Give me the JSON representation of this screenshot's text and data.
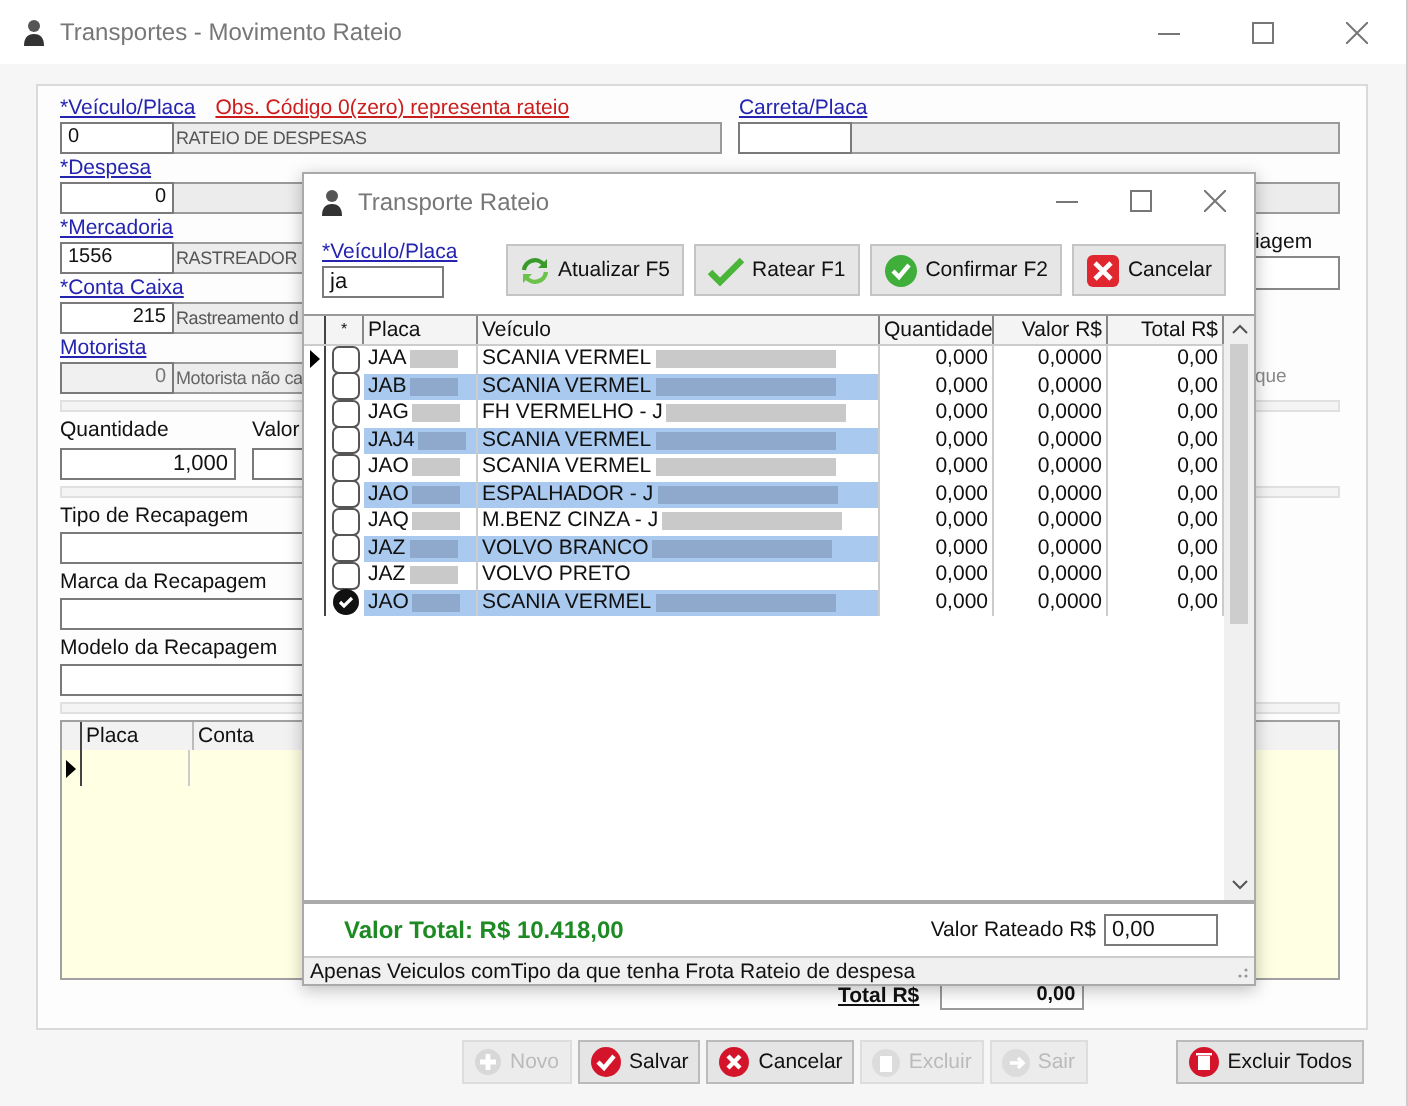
{
  "window": {
    "title": "Transportes - Movimento Rateio"
  },
  "form": {
    "obs": "Obs. Código 0(zero) representa rateio",
    "lookups": [
      {
        "label": "*Veículo/Placa",
        "code": "0",
        "description": "RATEIO DE DESPESAS",
        "kind": "text",
        "disabled": false
      },
      {
        "label": "*Despesa",
        "code": "0",
        "kind": "number",
        "disabled": false
      },
      {
        "label": "*Mercadoria",
        "code": "1556",
        "description": "RASTREADOR",
        "kind": "text",
        "disabled": false
      },
      {
        "label": "*Conta Caixa",
        "code": "215",
        "description": "Rastreamento d",
        "kind": "number",
        "disabled": false
      },
      {
        "label": "Motorista",
        "code": "0",
        "description": "Motorista não ca",
        "kind": "number",
        "disabled": true
      }
    ],
    "carreta": {
      "label": "Carreta/Placa"
    },
    "right_labels": [
      "iagem",
      "que"
    ],
    "quantidade": {
      "label": "Quantidade",
      "value": "1,000"
    },
    "valor": {
      "label": "Valor"
    },
    "recapagem": [
      {
        "label": "Tipo de Recapagem"
      },
      {
        "label": "Marca da Recapagem"
      },
      {
        "label": "Modelo da Recapagem"
      }
    ]
  },
  "grid": {
    "columns": [
      "Placa",
      "Conta"
    ]
  },
  "total": {
    "label": "Total R$",
    "value": "0,00"
  },
  "buttons": [
    {
      "label": "Novo",
      "kind": "add",
      "disabled": true
    },
    {
      "label": "Salvar",
      "kind": "save",
      "disabled": false
    },
    {
      "label": "Cancelar",
      "kind": "cancel",
      "disabled": false
    },
    {
      "label": "Excluir",
      "kind": "delete",
      "disabled": true
    },
    {
      "label": "Sair",
      "kind": "exit",
      "disabled": true
    },
    {
      "label": "Excluir Todos",
      "kind": "delete_all",
      "disabled": false
    }
  ],
  "dialog": {
    "title": "Transporte Rateio",
    "filter": {
      "label": "*Veículo/Placa",
      "value": "ja"
    },
    "buttons": [
      {
        "label": "Atualizar F5",
        "kind": "refresh"
      },
      {
        "label": "Ratear F1",
        "kind": "apply"
      },
      {
        "label": "Confirmar F2",
        "kind": "confirm"
      },
      {
        "label": "Cancelar",
        "kind": "cancel"
      }
    ],
    "columns": [
      "*",
      "Placa",
      "Veículo",
      "Quantidade",
      "Valor R$",
      "Total R$"
    ],
    "rows": [
      {
        "placa": "JAA",
        "veiculo": "SCANIA VERMEL",
        "quantidade": "0,000",
        "valor": "0,0000",
        "total": "0,00",
        "checked": false,
        "selected": false,
        "current": true,
        "redacted": true
      },
      {
        "placa": "JAB",
        "veiculo": "SCANIA VERMEL",
        "quantidade": "0,000",
        "valor": "0,0000",
        "total": "0,00",
        "checked": false,
        "selected": true,
        "current": false,
        "redacted": true
      },
      {
        "placa": "JAG",
        "veiculo": "FH VERMELHO - J",
        "quantidade": "0,000",
        "valor": "0,0000",
        "total": "0,00",
        "checked": false,
        "selected": false,
        "current": false,
        "redacted": true
      },
      {
        "placa": "JAJ4",
        "veiculo": "SCANIA VERMEL",
        "quantidade": "0,000",
        "valor": "0,0000",
        "total": "0,00",
        "checked": false,
        "selected": true,
        "current": false,
        "redacted": true
      },
      {
        "placa": "JAO",
        "veiculo": "SCANIA VERMEL",
        "quantidade": "0,000",
        "valor": "0,0000",
        "total": "0,00",
        "checked": false,
        "selected": false,
        "current": false,
        "redacted": true
      },
      {
        "placa": "JAO",
        "veiculo": "ESPALHADOR - J",
        "quantidade": "0,000",
        "valor": "0,0000",
        "total": "0,00",
        "checked": false,
        "selected": true,
        "current": false,
        "redacted": true
      },
      {
        "placa": "JAQ",
        "veiculo": "M.BENZ CINZA - J",
        "quantidade": "0,000",
        "valor": "0,0000",
        "total": "0,00",
        "checked": false,
        "selected": false,
        "current": false,
        "redacted": true
      },
      {
        "placa": "JAZ",
        "veiculo": "VOLVO BRANCO",
        "quantidade": "0,000",
        "valor": "0,0000",
        "total": "0,00",
        "checked": false,
        "selected": true,
        "current": false,
        "redacted": true
      },
      {
        "placa": "JAZ",
        "veiculo": "VOLVO PRETO",
        "quantidade": "0,000",
        "valor": "0,0000",
        "total": "0,00",
        "checked": false,
        "selected": false,
        "current": false,
        "redacted": false
      },
      {
        "placa": "JAO",
        "veiculo": "SCANIA VERMEL",
        "quantidade": "0,000",
        "valor": "0,0000",
        "total": "0,00",
        "checked": true,
        "selected": true,
        "current": false,
        "redacted": true
      }
    ],
    "valor_total": "Valor Total: R$ 10.418,00",
    "valor_rateado": {
      "label": "Valor Rateado R$",
      "value": "0,00"
    },
    "status": "Apenas Veiculos comTipo da que tenha Frota Rateio de despesa"
  }
}
